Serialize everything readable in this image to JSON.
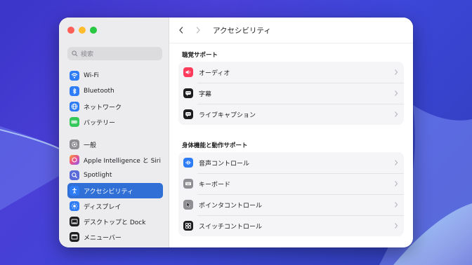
{
  "window": {
    "title": "アクセシビリティ"
  },
  "sidebar": {
    "search_placeholder": "検索",
    "items": [
      {
        "label": "Wi-Fi",
        "icon": "wifi-icon",
        "color": "#2f7df6"
      },
      {
        "label": "Bluetooth",
        "icon": "bluetooth-icon",
        "color": "#2f7df6"
      },
      {
        "label": "ネットワーク",
        "icon": "globe-icon",
        "color": "#2f7df6"
      },
      {
        "label": "バッテリー",
        "icon": "battery-icon",
        "color": "#34c759"
      },
      {
        "label": "一般",
        "icon": "gear-icon",
        "color": "#8e8e93"
      },
      {
        "label": "Apple Intelligence と Siri",
        "icon": "siri-icon",
        "color": "#e8508c"
      },
      {
        "label": "Spotlight",
        "icon": "search-icon",
        "color": "#5b6ad9"
      },
      {
        "label": "アクセシビリティ",
        "icon": "accessibility-icon",
        "color": "#2f7df6",
        "selected": true
      },
      {
        "label": "ディスプレイ",
        "icon": "sun-icon",
        "color": "#2f7df6"
      },
      {
        "label": "デスクトップと Dock",
        "icon": "dock-icon",
        "color": "#1d1d1f"
      },
      {
        "label": "メニューバー",
        "icon": "menubar-icon",
        "color": "#1d1d1f"
      }
    ]
  },
  "main": {
    "sections": [
      {
        "title": "聴覚サポート",
        "rows": [
          {
            "label": "オーディオ",
            "icon": "speaker-icon",
            "color": "#ff3b5c"
          },
          {
            "label": "字幕",
            "icon": "captions-icon",
            "color": "#1d1d1f"
          },
          {
            "label": "ライブキャプション",
            "icon": "live-captions-icon",
            "color": "#1d1d1f"
          }
        ]
      },
      {
        "title": "身体機能と動作サポート",
        "rows": [
          {
            "label": "音声コントロール",
            "icon": "voice-control-icon",
            "color": "#2f7df6"
          },
          {
            "label": "キーボード",
            "icon": "keyboard-icon",
            "color": "#8e8e93"
          },
          {
            "label": "ポインタコントロール",
            "icon": "pointer-icon",
            "color": "#8e8e93"
          },
          {
            "label": "スイッチコントロール",
            "icon": "switch-control-icon",
            "color": "#1d1d1f"
          }
        ]
      }
    ]
  },
  "theme": {
    "accent": "#2f6fd6",
    "sidebar_bg": "#ececef"
  }
}
